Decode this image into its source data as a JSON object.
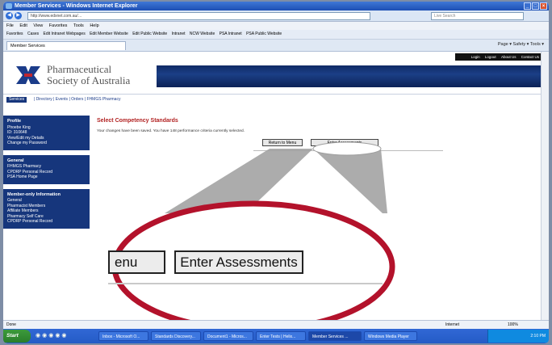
{
  "window": {
    "title": "Member Services - Windows Internet Explorer",
    "url": "http://www.edxnet.com.au/…",
    "search_placeholder": "Live Search"
  },
  "menu": [
    "File",
    "Edit",
    "View",
    "Favorites",
    "Tools",
    "Help"
  ],
  "favorites": [
    "Favorites",
    "Cases",
    "Edit Intranet Webpages",
    "Edit Member Website",
    "Edit Public Website",
    "Intranet",
    "NCW Website",
    "PSA Intranet",
    "PSA Public Website"
  ],
  "tab": {
    "label": "Member Services"
  },
  "ie_tools": "Page ▾  Safety ▾  Tools ▾",
  "site": {
    "logo_line1": "Pharmaceutical",
    "logo_line2": "Society of Australia",
    "nav_home": "Services",
    "nav_links": "| Directory | Events | Orders | FHMGS Pharmacy",
    "top_links": [
      "Login",
      "Logout",
      "About Us",
      "Contact Us"
    ]
  },
  "sidebar": [
    {
      "heading": "Profile",
      "items": [
        "Phoebe King",
        "ID: 310648",
        "View/Edit my Details",
        "Change my Password"
      ]
    },
    {
      "heading": "General",
      "items": [
        "FHMGS Pharmacy",
        "CPDRP Personal Record",
        "PSA Home Page"
      ]
    },
    {
      "heading": "Member-only Information",
      "items": [
        "General",
        "Pharmacist Members",
        "Affiliate Members",
        "Pharmacy Self Care",
        "CPDRP Personal Record"
      ]
    }
  ],
  "main": {
    "title": "Select Competency Standards",
    "message": "Your changes have been saved. You have 148 performance criteria currently selected.",
    "return_label": "Return to Menu",
    "enter_label": "Enter Assessments"
  },
  "zoom": {
    "return_fragment": "enu",
    "enter_label": "Enter Assessments"
  },
  "status": {
    "left": "Done",
    "zone": "Internet",
    "zoom": "100%"
  },
  "taskbar": {
    "start": "Start",
    "items": [
      "Inbox - Microsoft O...",
      "Standards Discovery...",
      "Document1 - Micros...",
      "Enter Tests | Helix...",
      "Member Services ...",
      "Windows Media Player"
    ],
    "clock": "2:10 PM"
  }
}
